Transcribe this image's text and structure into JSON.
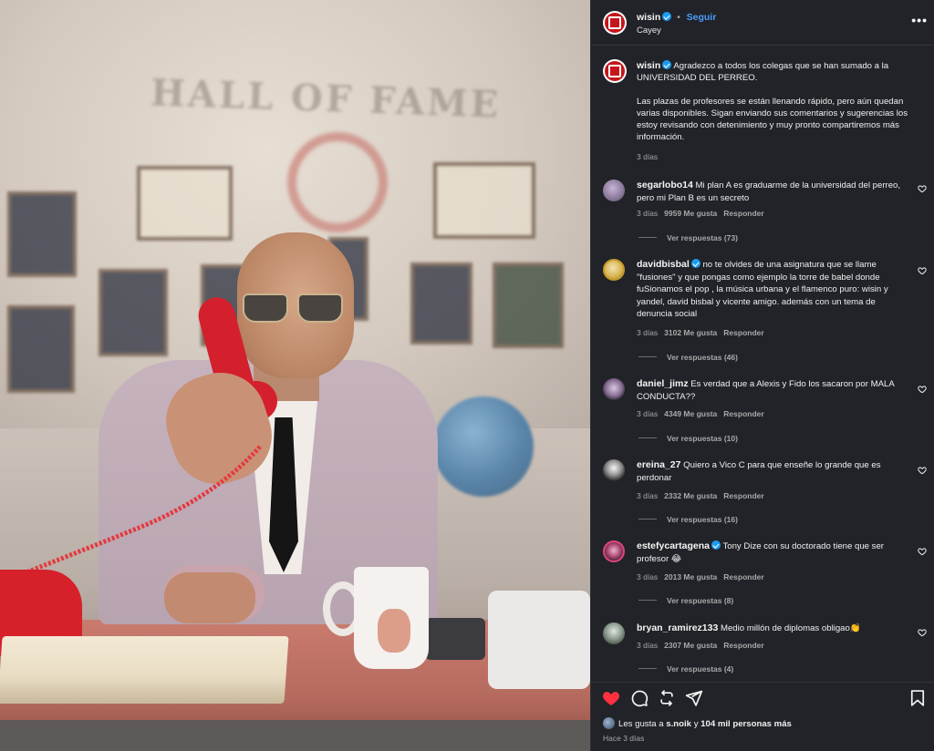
{
  "header": {
    "username": "wisin",
    "separator": "•",
    "follow_label": "Seguir",
    "location": "Cayey",
    "more_icon": "more-horizontal-icon"
  },
  "caption": {
    "username": "wisin",
    "paragraph1": "Agradezco a todos los colegas que se han sumado a la UNIVERSIDAD DEL PERREO.",
    "paragraph2": "Las plazas de profesores se están llenando rápido, pero aún quedan varias disponibles. Sigan enviando sus comentarios y sugerencias los estoy revisando con detenimiento y muy pronto compartiremos más información.",
    "time": "3 días"
  },
  "comments": [
    {
      "username": "segarlobo14",
      "verified": false,
      "text": "Mi plan A es graduarme de la universidad del perreo, pero mi Plan B es un secreto",
      "time": "3 días",
      "likes": "9959 Me gusta",
      "reply": "Responder",
      "replies": "Ver respuestas (73)"
    },
    {
      "username": "davidbisbal",
      "verified": true,
      "text": "no te olvides de una asignatura que se llame \"fusiones\" y que pongas como ejemplo la torre de babel donde fuSionamos el pop , la música urbana y el flamenco puro: wisin y yandel, david bisbal y vicente amigo. además con un tema de denuncia social",
      "time": "3 días",
      "likes": "3102 Me gusta",
      "reply": "Responder",
      "replies": "Ver respuestas (46)"
    },
    {
      "username": "daniel_jimz",
      "verified": false,
      "text": "Es verdad que a Alexis y Fido los sacaron por MALA CONDUCTA??",
      "time": "3 días",
      "likes": "4349 Me gusta",
      "reply": "Responder",
      "replies": "Ver respuestas (10)"
    },
    {
      "username": "ereina_27",
      "verified": false,
      "text": "Quiero a Vico C para que enseñe lo grande que es perdonar",
      "time": "3 días",
      "likes": "2332 Me gusta",
      "reply": "Responder",
      "replies": "Ver respuestas (16)"
    },
    {
      "username": "estefycartagena",
      "verified": true,
      "text": "Tony Dize con su doctorado tiene que ser profesor 😂",
      "time": "3 días",
      "likes": "2013 Me gusta",
      "reply": "Responder",
      "replies": "Ver respuestas (8)"
    },
    {
      "username": "bryan_ramirez133",
      "verified": false,
      "text": "Medio millón de diplomas obligao👏",
      "time": "3 días",
      "likes": "2307 Me gusta",
      "reply": "Responder",
      "replies": "Ver respuestas (4)"
    }
  ],
  "photo": {
    "wall_sign": "HALL OF FAME"
  },
  "footer": {
    "likes_prefix": "Les gusta a",
    "likes_user": "s.noik",
    "likes_mid": "y",
    "likes_count": "104 mil personas más",
    "posted": "Hace 3 días",
    "icons": [
      "heart-filled-icon",
      "comment-icon",
      "repost-icon",
      "share-icon",
      "bookmark-icon"
    ]
  },
  "colors": {
    "accent_link": "#4a9df8",
    "like_red": "#ff3040",
    "verified_blue": "#1d9bf0",
    "panel_bg": "#212328"
  }
}
